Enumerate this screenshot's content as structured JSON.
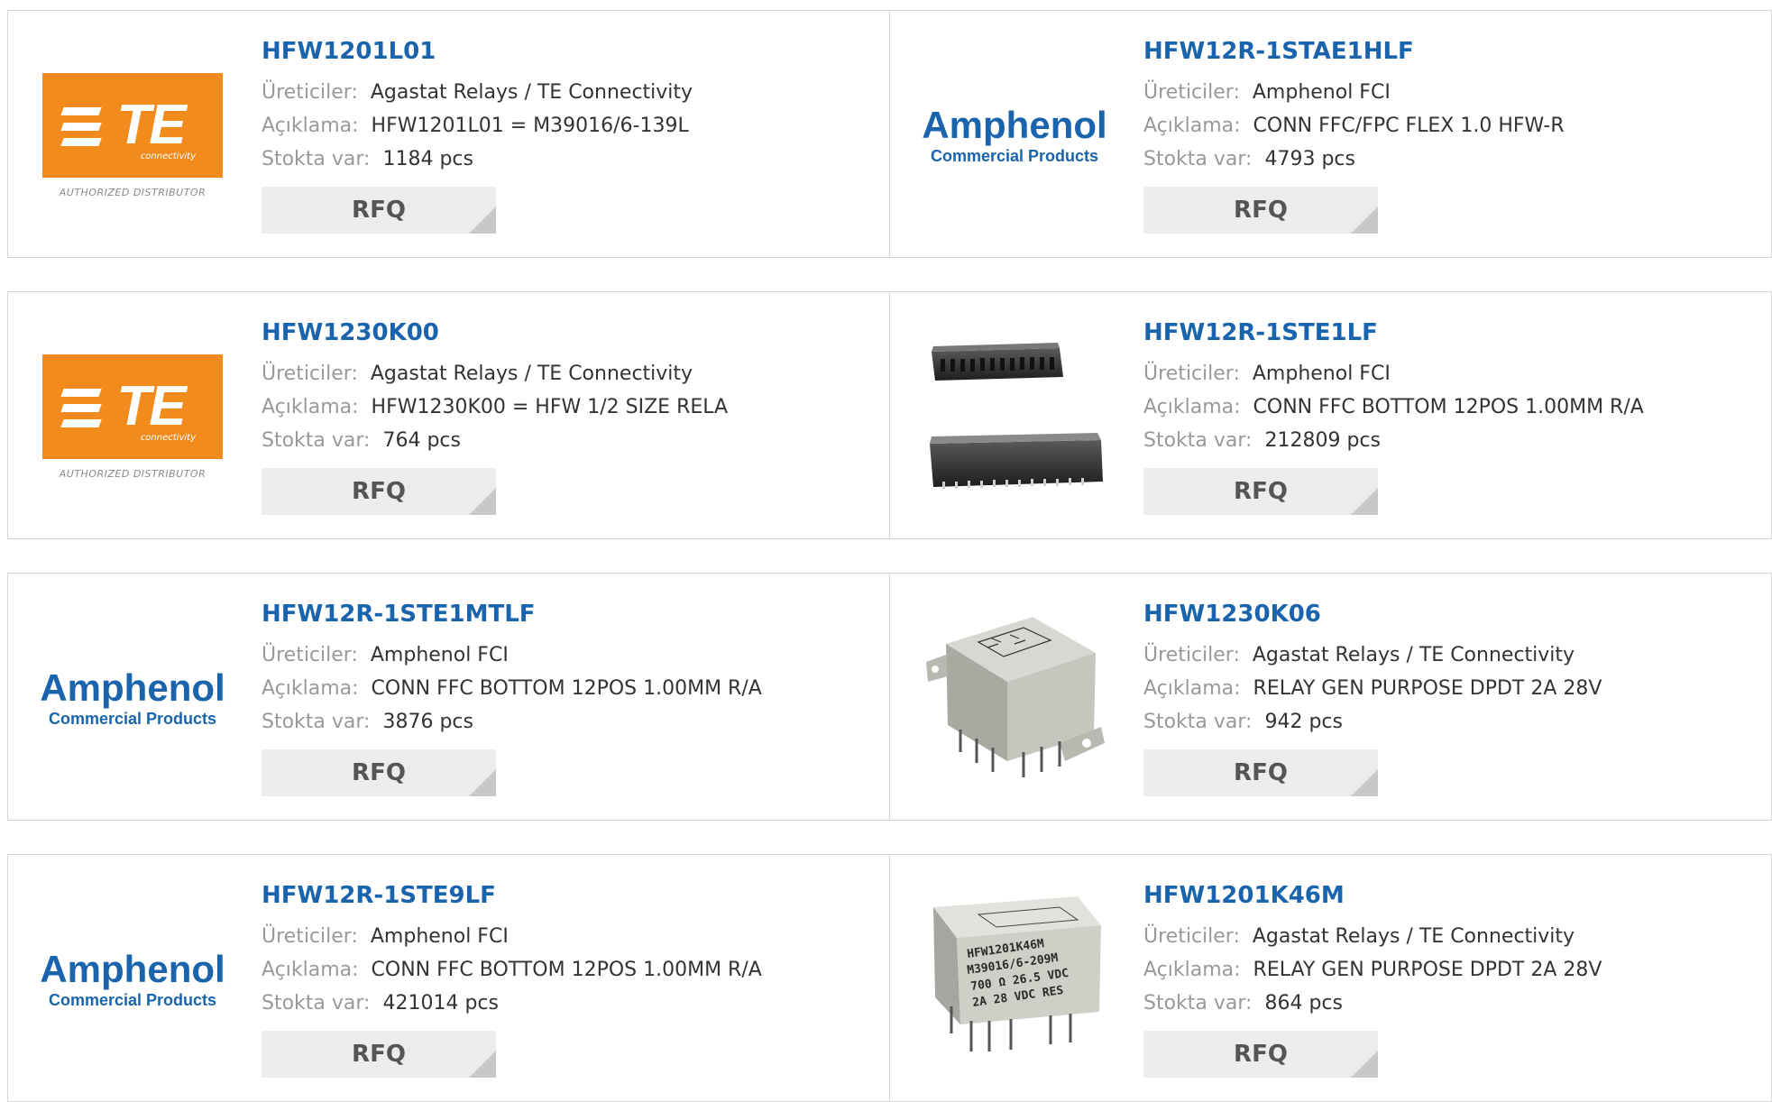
{
  "labels": {
    "manufacturer": "Üreticiler:",
    "description": "Açıklama:",
    "stock": "Stokta var:",
    "rfq": "RFQ"
  },
  "logos": {
    "te_mark": "TE",
    "te_sub": "connectivity",
    "te_distributor": "AUTHORIZED DISTRIBUTOR",
    "amphenol_name": "Amphenol",
    "amphenol_sub": "Commercial Products",
    "relay_marking": [
      "HFW1201K46M",
      "M39016/6-209M",
      "700 Ω 26.5 VDC",
      "2A 28 VDC RES"
    ]
  },
  "colors": {
    "link": "#1a63ad",
    "te_orange": "#f28b1c",
    "button": "#ececec"
  },
  "products": [
    {
      "part": "HFW1201L01",
      "manufacturer": "Agastat Relays / TE Connectivity",
      "description": "HFW1201L01 = M39016/6-139L",
      "stock": "1184 pcs",
      "image": "te-logo"
    },
    {
      "part": "HFW12R-1STAE1HLF",
      "manufacturer": "Amphenol FCI",
      "description": "CONN FFC/FPC FLEX 1.0 HFW-R",
      "stock": "4793 pcs",
      "image": "amphenol-logo"
    },
    {
      "part": "HFW1230K00",
      "manufacturer": "Agastat Relays / TE Connectivity",
      "description": "HFW1230K00 = HFW 1/2 SIZE RELA",
      "stock": "764 pcs",
      "image": "te-logo"
    },
    {
      "part": "HFW12R-1STE1LF",
      "manufacturer": "Amphenol FCI",
      "description": "CONN FFC BOTTOM 12POS 1.00MM R/A",
      "stock": "212809 pcs",
      "image": "connector-photo"
    },
    {
      "part": "HFW12R-1STE1MTLF",
      "manufacturer": "Amphenol FCI",
      "description": "CONN FFC BOTTOM 12POS 1.00MM R/A",
      "stock": "3876 pcs",
      "image": "amphenol-logo"
    },
    {
      "part": "HFW1230K06",
      "manufacturer": "Agastat Relays / TE Connectivity",
      "description": "RELAY GEN PURPOSE DPDT 2A 28V",
      "stock": "942 pcs",
      "image": "relay-photo"
    },
    {
      "part": "HFW12R-1STE9LF",
      "manufacturer": "Amphenol FCI",
      "description": "CONN FFC BOTTOM 12POS 1.00MM R/A",
      "stock": "421014 pcs",
      "image": "amphenol-logo"
    },
    {
      "part": "HFW1201K46M",
      "manufacturer": "Agastat Relays / TE Connectivity",
      "description": "RELAY GEN PURPOSE DPDT 2A 28V",
      "stock": "864 pcs",
      "image": "relay-marked-photo"
    }
  ]
}
